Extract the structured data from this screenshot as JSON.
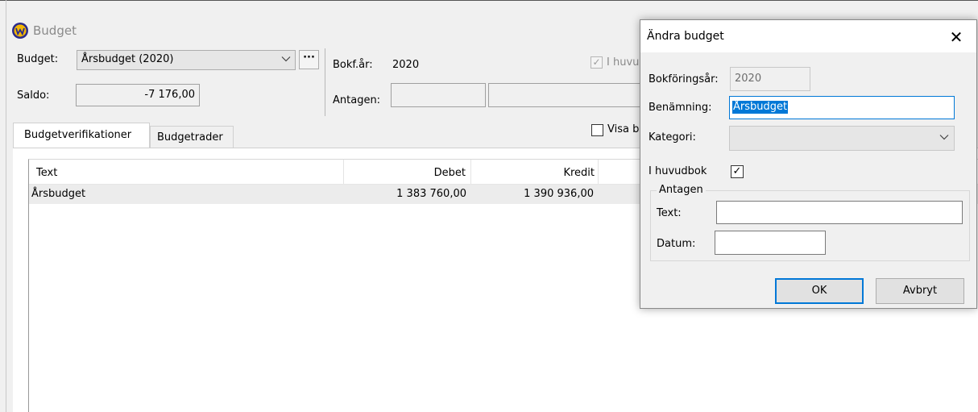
{
  "window": {
    "title": "Budget"
  },
  "budget_panel": {
    "budget_label": "Budget:",
    "budget_value": "Årsbudget (2020)",
    "more_label": "···",
    "saldo_label": "Saldo:",
    "saldo_value": "-7 176,00",
    "bokfar_label": "Bokf.år:",
    "bokfar_value": "2020",
    "i_huvudbok_partial": "I huvu",
    "antagen_label": "Antagen:",
    "visa_partial": "Visa b"
  },
  "tabs": [
    {
      "label": "Budgetverifikationer",
      "active": true
    },
    {
      "label": "Budgetrader",
      "active": false
    }
  ],
  "table": {
    "columns": [
      "Text",
      "Debet",
      "Kredit"
    ],
    "rows": [
      {
        "text": "Årsbudget",
        "debet": "1 383 760,00",
        "kredit": "1 390 936,00"
      }
    ]
  },
  "dialog": {
    "title": "Ändra budget",
    "close_glyph": "✕",
    "bokforingsar_label": "Bokföringsår:",
    "bokforingsar_value": "2020",
    "benamning_label": "Benämning:",
    "benamning_value": "Årsbudget",
    "kategori_label": "Kategori:",
    "kategori_value": "",
    "i_huvudbok_label": "I huvudbok",
    "i_huvudbok_checked": true,
    "check_glyph": "✓",
    "antagen_group_label": "Antagen",
    "text_label": "Text:",
    "text_value": "",
    "datum_label": "Datum:",
    "datum_value": "",
    "ok_label": "OK",
    "cancel_label": "Avbryt"
  },
  "icons": {
    "app": "app-logo-icon",
    "dropdown": "chevron-down-icon",
    "close": "close-icon",
    "check": "check-icon"
  },
  "colors": {
    "accent": "#0078d7",
    "background": "#f0f0f0",
    "row_highlight": "#ececec"
  }
}
